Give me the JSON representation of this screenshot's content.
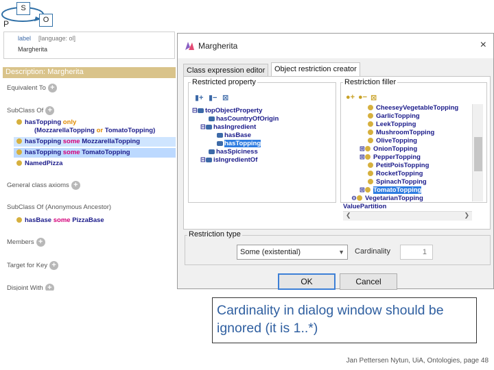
{
  "spo": {
    "s": "S",
    "p": "P",
    "o": "O"
  },
  "annotations": {
    "label_key": "label",
    "label_lang": "[language: ol]",
    "label_value": "Margherita"
  },
  "description": {
    "header": "Description: Margherita",
    "sections": {
      "equivalent": "Equivalent To",
      "subclass": "SubClass Of",
      "general_axioms": "General class axioms",
      "anon_ancestor": "SubClass Of (Anonymous Ancestor)",
      "members": "Members",
      "target_key": "Target for Key",
      "disjoint": "Disjoint With"
    },
    "subclass_rows": [
      {
        "prop": "hasTopping",
        "kw": "only",
        "filler": ""
      },
      {
        "paren_open": "(MozzarellaTopping",
        "or": "or",
        "paren_close": "TomatoTopping)"
      },
      {
        "prop": "hasTopping",
        "kw": "some",
        "filler": "MozzarellaTopping"
      },
      {
        "prop": "hasTopping",
        "kw": "some",
        "filler": "TomatoTopping"
      },
      {
        "filler": "NamedPizza"
      }
    ],
    "anon_rows": [
      {
        "prop": "hasBase",
        "kw": "some",
        "filler": "PizzaBase"
      }
    ]
  },
  "dialog": {
    "title": "Margherita",
    "close": "×",
    "tabs": [
      "Class expression editor",
      "Object restriction creator"
    ],
    "restricted_property": {
      "label": "Restricted property",
      "items": [
        {
          "toggle": "⊟",
          "text": "topObjectProperty"
        },
        {
          "toggle": "",
          "text": "hasCountryOfOrigin"
        },
        {
          "toggle": "⊟",
          "text": "hasIngredient"
        },
        {
          "toggle": "",
          "text": "hasBase"
        },
        {
          "toggle": "",
          "text": "hasTopping"
        },
        {
          "toggle": "",
          "text": "hasSpiciness"
        },
        {
          "toggle": "⊟",
          "text": "isIngredientOf"
        }
      ]
    },
    "restriction_filler": {
      "label": "Restriction filler",
      "items": [
        {
          "toggle": "",
          "text": "CheeseyVegetableTopping"
        },
        {
          "toggle": "",
          "text": "GarlicTopping"
        },
        {
          "toggle": "",
          "text": "LeekTopping"
        },
        {
          "toggle": "",
          "text": "MushroomTopping"
        },
        {
          "toggle": "",
          "text": "OliveTopping"
        },
        {
          "toggle": "⊞",
          "text": "OnionTopping"
        },
        {
          "toggle": "⊞",
          "text": "PepperTopping"
        },
        {
          "toggle": "",
          "text": "PetitPoisTopping"
        },
        {
          "toggle": "",
          "text": "RocketTopping"
        },
        {
          "toggle": "",
          "text": "SpinachTopping"
        },
        {
          "toggle": "⊞",
          "text": "TomatoTopping"
        },
        {
          "toggle": "⊖",
          "text": "VegetarianTopping"
        },
        {
          "toggle": "",
          "text": "ValuePartition"
        }
      ]
    },
    "restriction_type": {
      "label": "Restriction type",
      "value": "Some (existential)",
      "cardinality_label": "Cardinality",
      "cardinality_value": "1"
    },
    "ok": "OK",
    "cancel": "Cancel"
  },
  "callout": "Cardinality in dialog window should be ignored (it is 1..*)",
  "footer": "Jan Pettersen Nytun, UiA, Ontologies, page 48",
  "colors": {
    "accent": "#2f7de1",
    "callout_text": "#2f5fa0",
    "desc_bar": "#d9c38a"
  }
}
